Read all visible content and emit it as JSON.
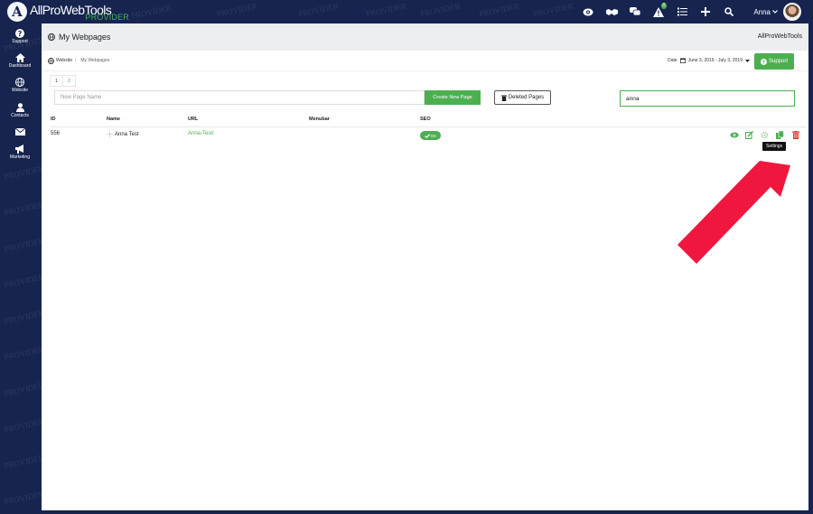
{
  "brand": {
    "initial": "A",
    "name": "AllProWebTools",
    "tagline": "PROVIDER"
  },
  "watermark": "PROVIDER",
  "topbar": {
    "icons": [
      "eye-icon",
      "handshake-icon",
      "chat-icon",
      "alert-icon",
      "checklist-icon",
      "plus-icon",
      "search-icon"
    ],
    "alert_count": "0",
    "user_name": "Anna"
  },
  "sidebar": {
    "items": [
      {
        "label": "Support",
        "icon": "question-icon"
      },
      {
        "label": "Dashboard",
        "icon": "home-icon"
      },
      {
        "label": "Website",
        "icon": "globe-icon"
      },
      {
        "label": "Contacts",
        "icon": "person-icon"
      },
      {
        "label": "Marketing",
        "icon": "megaphone-icon"
      }
    ]
  },
  "header": {
    "title": "My Webpages",
    "brand_right": "AllProWebTools"
  },
  "breadcrumb": {
    "root": "Website",
    "current": "My Webpages"
  },
  "date_filter": {
    "label": "Date",
    "range": "June 3, 2019 - July 3, 2019"
  },
  "support_button": "Support",
  "pagination": [
    "1",
    "2"
  ],
  "new_page": {
    "placeholder": "New Page Name",
    "button": "Create New Page"
  },
  "deleted_pages_button": "Deleted Pages",
  "search": {
    "value": "anna"
  },
  "table": {
    "columns": [
      "ID",
      "Name",
      "URL",
      "Menubar",
      "SEO"
    ],
    "rows": [
      {
        "id": "556",
        "name": "Anna Test",
        "url": "Anna-Test/",
        "menubar": "",
        "seo": "OK"
      }
    ]
  },
  "tooltip": "Settings",
  "colors": {
    "navy": "#16244f",
    "green": "#4caf50",
    "red": "#f0173f",
    "delete": "#e53935"
  }
}
